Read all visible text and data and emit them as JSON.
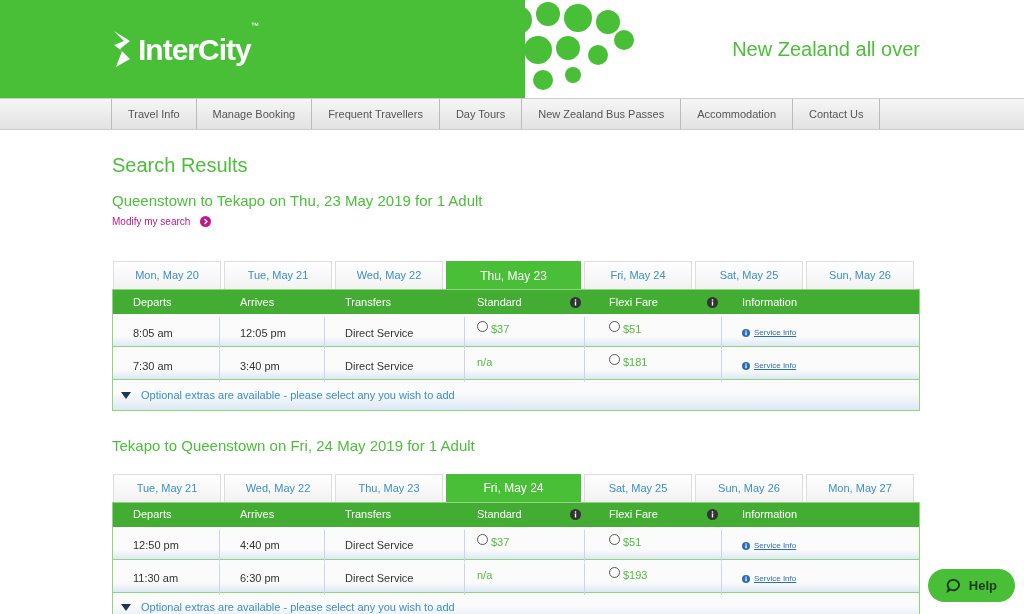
{
  "header": {
    "logo": "InterCity",
    "trademark": "™",
    "tagline": "New Zealand all over"
  },
  "nav": [
    {
      "label": "Travel Info"
    },
    {
      "label": "Manage Booking"
    },
    {
      "label": "Frequent Travellers"
    },
    {
      "label": "Day Tours"
    },
    {
      "label": "New Zealand Bus Passes"
    },
    {
      "label": "Accommodation"
    },
    {
      "label": "Contact Us"
    }
  ],
  "page_title": "Search Results",
  "trips": [
    {
      "title": "Queenstown to Tekapo on Thu, 23 May 2019 for 1 Adult",
      "modify_link": "Modify my search",
      "tabs": [
        {
          "label": "Mon, May 20",
          "selected": false
        },
        {
          "label": "Tue, May 21",
          "selected": false
        },
        {
          "label": "Wed, May 22",
          "selected": false
        },
        {
          "label": "Thu, May 23",
          "selected": true
        },
        {
          "label": "Fri, May 24",
          "selected": false
        },
        {
          "label": "Sat, May 25",
          "selected": false
        },
        {
          "label": "Sun, May 26",
          "selected": false
        }
      ],
      "columns": [
        "Departs",
        "Arrives",
        "Transfers",
        "Standard",
        "Flexi Fare",
        "Information"
      ],
      "rows": [
        {
          "departs": "8:05 am",
          "arrives": "12:05 pm",
          "transfers": "Direct Service",
          "standard": {
            "kind": "option",
            "price": "$37",
            "selected": false
          },
          "flexi": {
            "kind": "option",
            "price": "$51",
            "selected": false
          },
          "info": "Service Info"
        },
        {
          "departs": "7:30 am",
          "arrives": "3:40 pm",
          "transfers": "Direct Service",
          "standard": {
            "kind": "unavailable",
            "price": "n/a"
          },
          "flexi": {
            "kind": "option",
            "price": "$181",
            "selected": false
          },
          "info": "Service Info"
        }
      ],
      "extras": "Optional extras are available - please select any you wish to add"
    },
    {
      "title": "Tekapo to Queenstown on Fri, 24 May 2019 for 1 Adult",
      "tabs": [
        {
          "label": "Tue, May 21",
          "selected": false
        },
        {
          "label": "Wed, May 22",
          "selected": false
        },
        {
          "label": "Thu, May 23",
          "selected": false
        },
        {
          "label": "Fri, May 24",
          "selected": true
        },
        {
          "label": "Sat, May 25",
          "selected": false
        },
        {
          "label": "Sun, May 26",
          "selected": false
        },
        {
          "label": "Mon, May 27",
          "selected": false
        }
      ],
      "columns": [
        "Departs",
        "Arrives",
        "Transfers",
        "Standard",
        "Flexi Fare",
        "Information"
      ],
      "rows": [
        {
          "departs": "12:50 pm",
          "arrives": "4:40 pm",
          "transfers": "Direct Service",
          "standard": {
            "kind": "option",
            "price": "$37",
            "selected": false
          },
          "flexi": {
            "kind": "option",
            "price": "$51",
            "selected": false
          },
          "info": "Service Info"
        },
        {
          "departs": "11:30 am",
          "arrives": "6:30 pm",
          "transfers": "Direct Service",
          "standard": {
            "kind": "unavailable",
            "price": "n/a"
          },
          "flexi": {
            "kind": "option",
            "price": "$193",
            "selected": false
          },
          "info": "Service Info"
        }
      ],
      "extras": "Optional extras are available - please select any you wish to add"
    }
  ],
  "help_button": "Help"
}
